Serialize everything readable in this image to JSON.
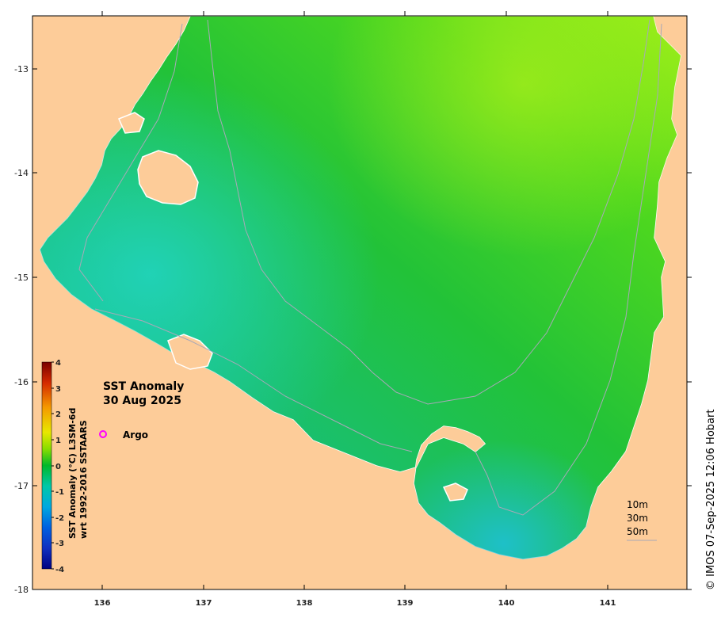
{
  "map": {
    "title_line1": "SST Anomaly",
    "title_line2": "30 Aug 2025",
    "credit": "© IMOS 07-Sep-2025 12:06 Hobart",
    "x_ticks": [
      "136",
      "137",
      "138",
      "139",
      "140",
      "141"
    ],
    "y_ticks": [
      "-13",
      "-14",
      "-15",
      "-16",
      "-17",
      "-18"
    ],
    "legend": {
      "marker_icon": "circle-marker-icon",
      "marker_color": "#ff00ff",
      "label": "Argo"
    },
    "contours": [
      "10m",
      "30m",
      "50m"
    ],
    "colorbar": {
      "title_line1": "SST Anomaly (°C) L3SM-6d",
      "title_line2": "wrt 1992-2016 SSTAARS",
      "ticks": [
        "4",
        "3",
        "2",
        "1",
        "0",
        "-1",
        "-2",
        "-3",
        "-4"
      ],
      "range": [
        -4,
        4
      ]
    },
    "colors": {
      "land": "#fdcc99",
      "ocean_near_zero": "#1cbd3a",
      "ocean_cool": "#1fd3a8",
      "ocean_warm": "#8fe81a"
    }
  }
}
